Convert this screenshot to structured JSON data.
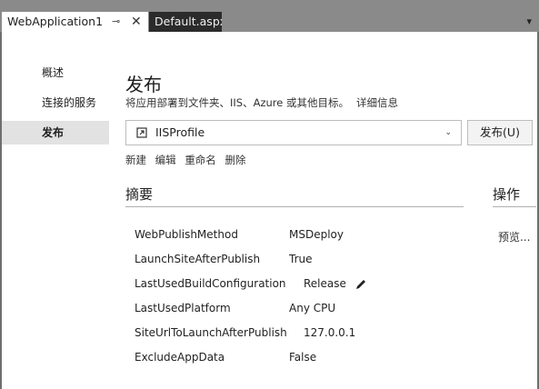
{
  "tabs": [
    {
      "label": "WebApplication1",
      "active": true
    },
    {
      "label": "Default.aspx",
      "active": false
    }
  ],
  "tab_glyphs": {
    "pin": "⊸",
    "close": "✕",
    "scroll": "▾"
  },
  "sidebar": {
    "items": [
      {
        "label": "概述",
        "selected": false
      },
      {
        "label": "连接的服务",
        "selected": false
      },
      {
        "label": "发布",
        "selected": true
      }
    ]
  },
  "main": {
    "title": "发布",
    "description": "将应用部署到文件夹、IIS、Azure 或其他目标。",
    "details_link": "详细信息",
    "profile": {
      "name": "IISProfile",
      "chevron": "⌄"
    },
    "publish_button": "发布(U)",
    "profile_actions": [
      "新建",
      "编辑",
      "重命名",
      "删除"
    ],
    "summary_heading": "摘要",
    "actions_heading": "操作",
    "preview_link": "预览...",
    "properties": [
      {
        "key": "WebPublishMethod",
        "value": "MSDeploy"
      },
      {
        "key": "LaunchSiteAfterPublish",
        "value": "True"
      },
      {
        "key": "LastUsedBuildConfiguration",
        "value": "Release",
        "editable": true
      },
      {
        "key": "LastUsedPlatform",
        "value": "Any CPU"
      },
      {
        "key": "SiteUrlToLaunchAfterPublish",
        "value": "127.0.0.1"
      },
      {
        "key": "ExcludeAppData",
        "value": "False"
      }
    ]
  },
  "colors": {
    "chrome_bg": "#8a8a8a",
    "inactive_tab": "#2b2b2b",
    "selected_nav": "#e2e2e2",
    "rule": "#b0b0b0"
  }
}
